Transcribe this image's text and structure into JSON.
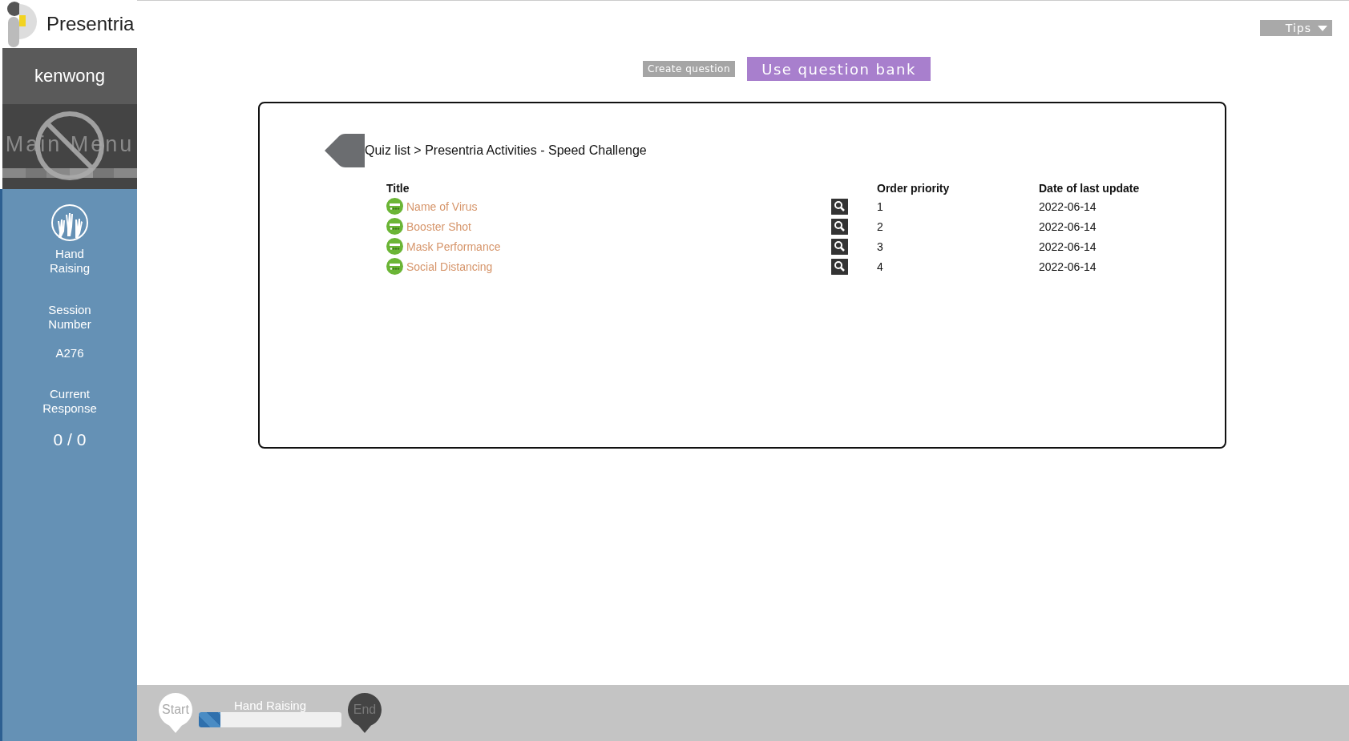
{
  "app": {
    "name": "Presentria"
  },
  "sidebar": {
    "username": "kenwong",
    "main_menu": {
      "label": "Main Menu",
      "disabled": true
    },
    "hand_raising": {
      "label": "Hand Raising"
    },
    "session": {
      "label": "Session Number",
      "value": "A276"
    },
    "response": {
      "label": "Current Response",
      "value": "0 / 0"
    }
  },
  "tips": {
    "label": "Tips"
  },
  "actions": [
    {
      "label": "Create question",
      "kind": "secondary"
    },
    {
      "label": "Use question bank",
      "kind": "primary"
    }
  ],
  "breadcrumb": "Quiz list > Presentria Activities - Speed Challenge",
  "table": {
    "columns": [
      "Title",
      "Order priority",
      "Date of last update"
    ],
    "rows": [
      {
        "title": "Name of Virus",
        "order": "1",
        "date": "2022-06-14"
      },
      {
        "title": "Booster Shot",
        "order": "2",
        "date": "2022-06-14"
      },
      {
        "title": "Mask Performance",
        "order": "3",
        "date": "2022-06-14"
      },
      {
        "title": "Social Distancing",
        "order": "4",
        "date": "2022-06-14"
      }
    ]
  },
  "bottom_bar": {
    "start": "Start",
    "activity": "Hand Raising",
    "level": 0.15,
    "end": "End"
  }
}
